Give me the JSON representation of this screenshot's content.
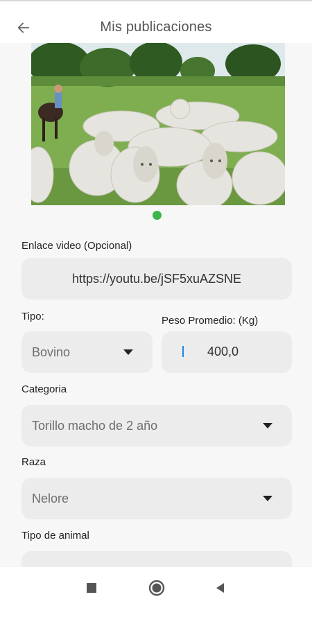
{
  "app_bar": {
    "title": "Mis publicaciones",
    "back_icon": "arrow-left-icon"
  },
  "gallery": {
    "image_description_icon": "cattle-photo",
    "indicator_color": "#3cb54a"
  },
  "form": {
    "video": {
      "label": "Enlace video (Opcional)",
      "value": "https://youtu.be/jSF5xuAZSNE"
    },
    "tipo": {
      "label": "Tipo:",
      "value": "Bovino"
    },
    "peso": {
      "label": "Peso Promedio: (Kg)",
      "value": "400,0"
    },
    "categoria": {
      "label": "Categoria",
      "value": "Torillo macho de 2 año"
    },
    "raza": {
      "label": "Raza",
      "value": "Nelore"
    },
    "tipo_animal": {
      "label": "Tipo de animal",
      "value": ""
    }
  },
  "nav": {
    "recents_icon": "square-icon",
    "home_icon": "circle-icon",
    "back_icon": "triangle-back-icon"
  },
  "colors": {
    "field_bg": "#ececec",
    "content_bg": "#f7f7f7",
    "cursor": "#1e88e5"
  }
}
